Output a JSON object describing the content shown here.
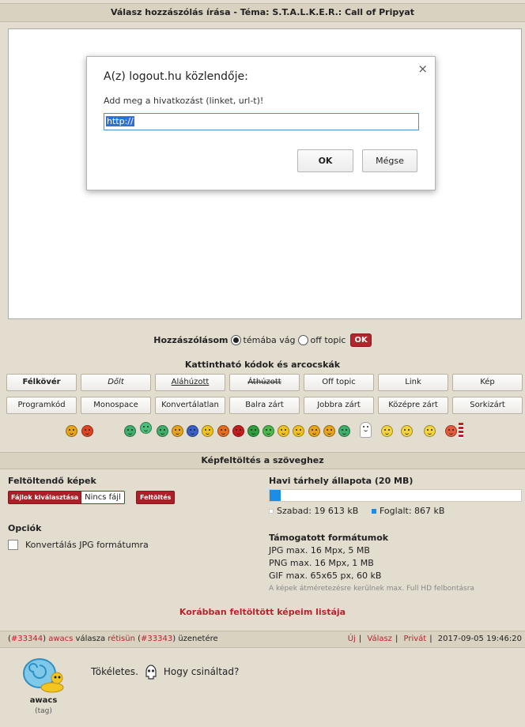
{
  "header": {
    "title": "Válasz hozzászólás írása - Téma: S.T.A.L.K.E.R.: Call of Pripyat"
  },
  "dialog": {
    "title": "A(z) logout.hu közlendője:",
    "message": "Add meg a hivatkozást (linket, url-t)!",
    "input_value": "http://",
    "ok_label": "OK",
    "cancel_label": "Mégse",
    "close_symbol": "×"
  },
  "reply": {
    "label": "Hozzászólásom",
    "option_on_topic": "témába vág",
    "option_off_topic": "off topic",
    "ok_label": "OK",
    "selected": "témába vág"
  },
  "codes": {
    "title": "Kattintható kódok és arcocskák",
    "row1": [
      "Félkövér",
      "Dőlt",
      "Aláhúzott",
      "Áthúzott",
      "Off topic",
      "Link",
      "Kép"
    ],
    "row2": [
      "Programkód",
      "Monospace",
      "Konvertálatlan",
      "Balra zárt",
      "Jobbra zárt",
      "Középre zárt",
      "Sorkizárt"
    ]
  },
  "smileys": [
    "smile",
    "angry",
    "grin",
    "robot",
    "teeth",
    "happy",
    "blue-face",
    "worried",
    "tongue",
    "red-angry",
    "green-grin",
    "green-smile",
    "smile",
    "smile",
    "wink",
    "green-laugh",
    "skull",
    "confused",
    "smile",
    "sleepy",
    "shout"
  ],
  "upload": {
    "section_title": "Képfeltöltés a szöveghez",
    "files_label": "Feltöltendő képek",
    "choose_files": "Fájlok kiválasztása",
    "no_file": "Nincs fájl",
    "upload_button": "Feltöltés",
    "options_label": "Opciók",
    "convert_jpg": "Konvertálás JPG formátumra",
    "storage_title": "Havi tárhely állapota (20 MB)",
    "storage_used_fraction": 0.043,
    "free": "Szabad: 19 613 kB",
    "used": "Foglalt: 867 kB",
    "formats_title": "Támogatott formátumok",
    "formats": [
      "JPG max. 16 Mpx, 5 MB",
      "PNG max. 16 Mpx, 1 MB",
      "GIF max. 65x65 px, 60 kB"
    ],
    "resize_note": "A képek átméretezésre kerülnek max. Full HD felbontásra",
    "previous_link": "Korábban feltöltött képeim listája"
  },
  "post": {
    "post_id": "#33344",
    "author": "awacs",
    "reply_word": "válasza",
    "reply_to": "rétisün",
    "reply_to_id": "#33343",
    "message_word": "üzenetére",
    "actions": [
      "Új",
      "Válasz",
      "Privát"
    ],
    "timestamp": "2017-09-05 19:46:20",
    "username": "awacs",
    "tag": "(tag)",
    "text_before": "Tökéletes.",
    "text_after": "Hogy csináltad?"
  },
  "colors": {
    "accent_red": "#b3262e",
    "storage_blue": "#1a8ee6",
    "bar_bg": "#d9d2c1"
  }
}
